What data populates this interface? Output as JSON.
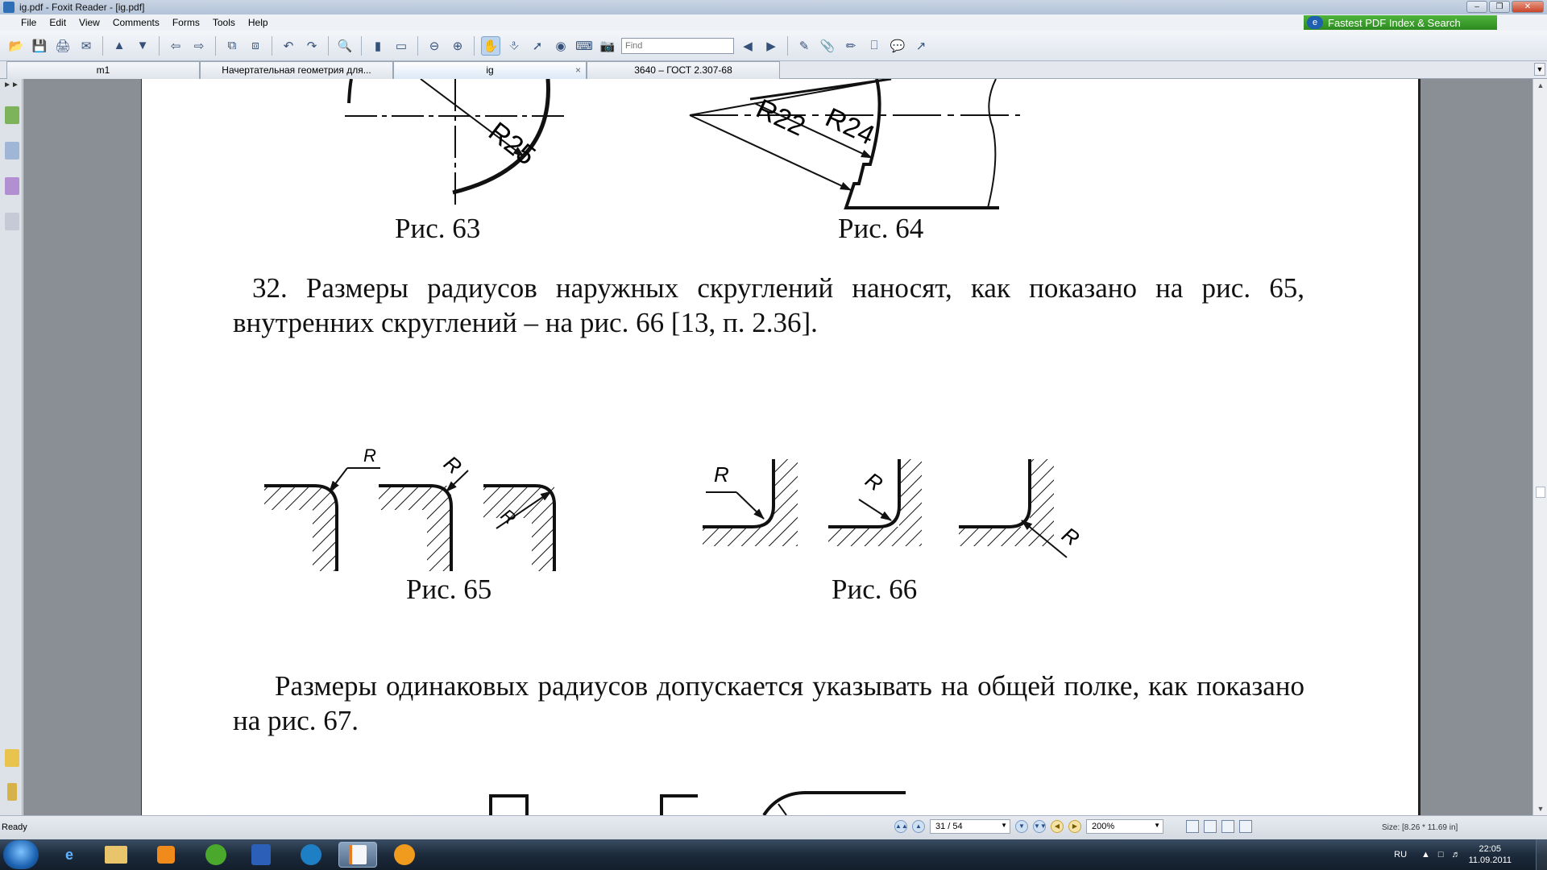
{
  "window": {
    "title": "ig.pdf - Foxit Reader - [ig.pdf]",
    "controls": {
      "minimize": "–",
      "restore": "❐",
      "close": "✕"
    }
  },
  "menu": {
    "items": [
      "File",
      "Edit",
      "View",
      "Comments",
      "Forms",
      "Tools",
      "Help"
    ]
  },
  "ad_banner": {
    "text": "Fastest PDF Index & Search",
    "icon": "e"
  },
  "toolbar": {
    "find_placeholder": "Find"
  },
  "tabs": [
    {
      "label": "m1"
    },
    {
      "label": "Начертательная геометрия для..."
    },
    {
      "label": "ig",
      "close": "×"
    },
    {
      "label": "3640 – ГОСТ 2.307-68"
    }
  ],
  "document": {
    "captions": {
      "fig63": "Рис. 63",
      "fig64": "Рис. 64",
      "fig65": "Рис. 65",
      "fig66": "Рис. 66"
    },
    "labels": {
      "r25": "R25",
      "r22": "R22",
      "r24": "R24",
      "r": "R"
    },
    "paragraph1": "32. Размеры радиусов наружных скруглений наносят, как показано на рис. 65, внутренних скруглений – на рис. 66 [13, п. 2.36].",
    "paragraph2": "Размеры  одинаковых  радиусов допускается указывать на общей полке, как показано на рис. 67."
  },
  "statusbar": {
    "ready": "Ready",
    "page_indicator": "31 / 54",
    "zoom": "200%",
    "size": "Size: [8.26 * 11.69 in]"
  },
  "taskbar": {
    "tray_lang": "RU",
    "clock_time": "22:05",
    "clock_date": "11.09.2011"
  },
  "colors": {
    "ad_green": "#2c8a1f",
    "page_bg": "#ffffff",
    "workspace": "#8a8f96"
  }
}
